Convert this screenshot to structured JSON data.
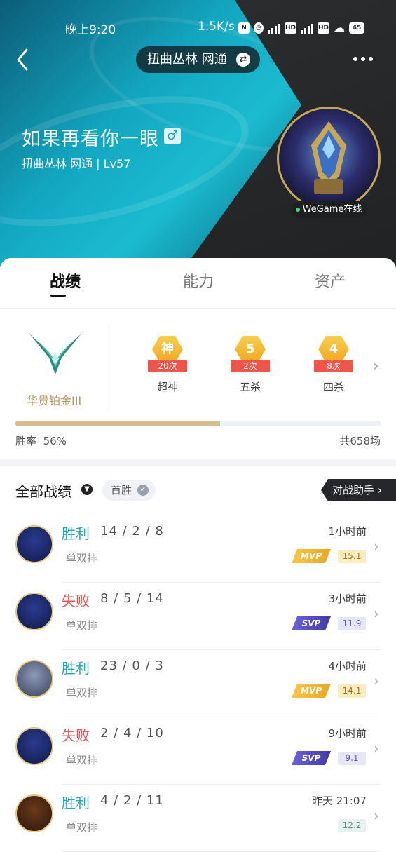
{
  "status_bar": {
    "time": "晚上9:20",
    "speed": "1.5K/s",
    "battery": "45"
  },
  "header": {
    "server": "扭曲丛林 网通",
    "swap_icon": "⇄",
    "player_name": "如果再看你一眼",
    "gender_icon": "♂",
    "sub_info": "扭曲丛林 网通 | Lv57",
    "online_status": "WeGame在线",
    "accent_color": "#1bbbd0"
  },
  "tabs": [
    {
      "label": "战绩",
      "active": true
    },
    {
      "label": "能力",
      "active": false
    },
    {
      "label": "资产",
      "active": false
    }
  ],
  "summary": {
    "rank": "华贵铂金III",
    "achievements": [
      {
        "icon": "神",
        "count": "20次",
        "label": "超神"
      },
      {
        "icon": "5",
        "count": "2次",
        "label": "五杀"
      },
      {
        "icon": "4",
        "count": "8次",
        "label": "四杀"
      }
    ],
    "win_rate_label": "胜率",
    "win_rate_value": "56%",
    "win_rate_fraction": 0.56,
    "total_games": "共658场"
  },
  "list": {
    "title": "全部战绩",
    "filter": "首胜",
    "assistant": "对战助手"
  },
  "matches": [
    {
      "result": "胜利",
      "outcome": "win",
      "kda": "14 / 2 / 8",
      "mode": "单双排",
      "time": "1小时前",
      "tag": "MVP",
      "score": "15.1",
      "score_type": "mvp"
    },
    {
      "result": "失败",
      "outcome": "loss",
      "kda": "8 / 5 / 14",
      "mode": "单双排",
      "time": "3小时前",
      "tag": "SVP",
      "score": "11.9",
      "score_type": "svp"
    },
    {
      "result": "胜利",
      "outcome": "win",
      "kda": "23 / 0 / 3",
      "mode": "单双排",
      "time": "4小时前",
      "tag": "MVP",
      "score": "14.1",
      "score_type": "mvp"
    },
    {
      "result": "失败",
      "outcome": "loss",
      "kda": "2 / 4 / 10",
      "mode": "单双排",
      "time": "9小时前",
      "tag": "SVP",
      "score": "9.1",
      "score_type": "svp"
    },
    {
      "result": "胜利",
      "outcome": "win",
      "kda": "4 / 2 / 11",
      "mode": "单双排",
      "time": "昨天 21:07",
      "tag": "",
      "score": "12.2",
      "score_type": "plain"
    }
  ]
}
